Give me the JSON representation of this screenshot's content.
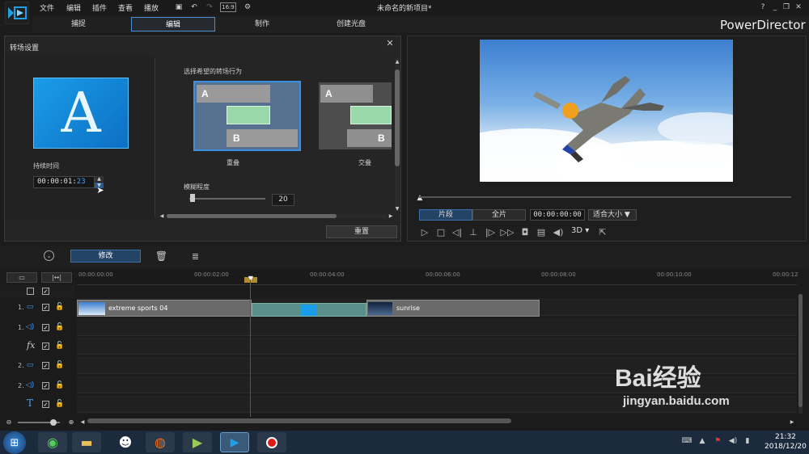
{
  "app": {
    "title": "未命名的新项目*",
    "brand": "PowerDirector"
  },
  "menu": [
    "文件",
    "编辑",
    "插件",
    "查看",
    "播放"
  ],
  "tabs": [
    "捕捉",
    "编辑",
    "制作",
    "创建光盘"
  ],
  "transition": {
    "panel_title": "转场设置",
    "preview_letter": "A",
    "duration_label": "持续时间",
    "duration_value": "00:00:01:",
    "duration_frames": "23",
    "behavior_label": "选择希望的转场行为",
    "option1": {
      "a": "A",
      "b": "B",
      "label": "重叠"
    },
    "option2": {
      "a": "A",
      "b": "B",
      "label": "交叠"
    },
    "blur_label": "模糊程度",
    "blur_value": "20",
    "blur_level": 0.04,
    "reset": "重置"
  },
  "preview": {
    "mode_clip": "片段",
    "mode_full": "全片",
    "timecode": "00:00:00:00",
    "fit": "适合大小",
    "mode_3d": "3D"
  },
  "toolbar": {
    "edit": "修改"
  },
  "timeline": {
    "ticks": [
      "00:00:00:00",
      "00:00:02:00",
      "00:00:04:00",
      "00:00:06:00",
      "00:00:08:00",
      "00:00:10:00",
      "00:00:12"
    ],
    "tracks": [
      "1.",
      "1.",
      "fx",
      "2.",
      "2.",
      "T"
    ],
    "clip1": "extreme sports 04",
    "clip2": "sunrise"
  },
  "clock": {
    "time": "21:32",
    "date": "2018/12/20"
  },
  "watermark": {
    "brand": "Bai经验",
    "url": "jingyan.baidu.com"
  },
  "colors": {
    "accent": "#3d8fe0",
    "playhead": "#c62828",
    "green": "#9ad7a9",
    "clipbar": "#6a6a6a"
  }
}
